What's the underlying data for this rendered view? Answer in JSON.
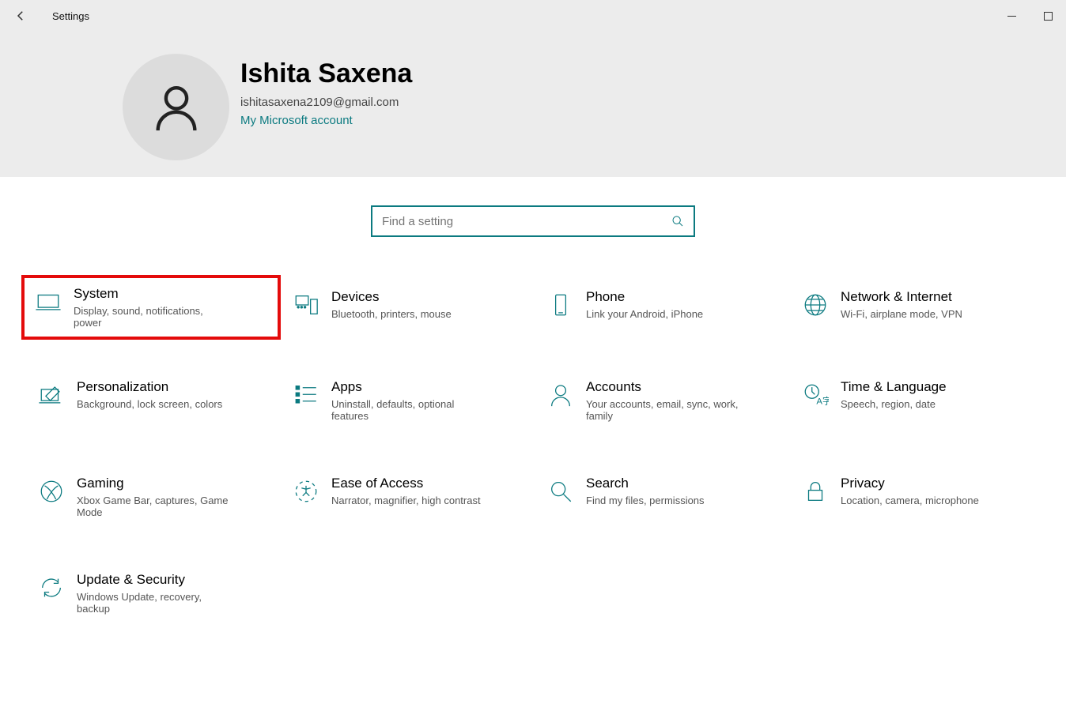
{
  "window": {
    "title": "Settings"
  },
  "user": {
    "name": "Ishita Saxena",
    "email": "ishitasaxena2109@gmail.com",
    "account_link": "My Microsoft account"
  },
  "search": {
    "placeholder": "Find a setting"
  },
  "tiles": [
    {
      "title": "System",
      "desc": "Display, sound, notifications, power",
      "icon": "monitor-icon",
      "highlight": true
    },
    {
      "title": "Devices",
      "desc": "Bluetooth, printers, mouse",
      "icon": "devices-icon",
      "highlight": false
    },
    {
      "title": "Phone",
      "desc": "Link your Android, iPhone",
      "icon": "phone-icon",
      "highlight": false
    },
    {
      "title": "Network & Internet",
      "desc": "Wi-Fi, airplane mode, VPN",
      "icon": "globe-icon",
      "highlight": false
    },
    {
      "title": "Personalization",
      "desc": "Background, lock screen, colors",
      "icon": "pen-monitor-icon",
      "highlight": false
    },
    {
      "title": "Apps",
      "desc": "Uninstall, defaults, optional features",
      "icon": "apps-list-icon",
      "highlight": false
    },
    {
      "title": "Accounts",
      "desc": "Your accounts, email, sync, work, family",
      "icon": "person-icon",
      "highlight": false
    },
    {
      "title": "Time & Language",
      "desc": "Speech, region, date",
      "icon": "time-language-icon",
      "highlight": false
    },
    {
      "title": "Gaming",
      "desc": "Xbox Game Bar, captures, Game Mode",
      "icon": "xbox-icon",
      "highlight": false
    },
    {
      "title": "Ease of Access",
      "desc": "Narrator, magnifier, high contrast",
      "icon": "accessibility-icon",
      "highlight": false
    },
    {
      "title": "Search",
      "desc": "Find my files, permissions",
      "icon": "magnifier-icon",
      "highlight": false
    },
    {
      "title": "Privacy",
      "desc": "Location, camera, microphone",
      "icon": "lock-icon",
      "highlight": false
    },
    {
      "title": "Update & Security",
      "desc": "Windows Update, recovery, backup",
      "icon": "sync-icon",
      "highlight": false
    }
  ],
  "accent": "#0b7a80"
}
